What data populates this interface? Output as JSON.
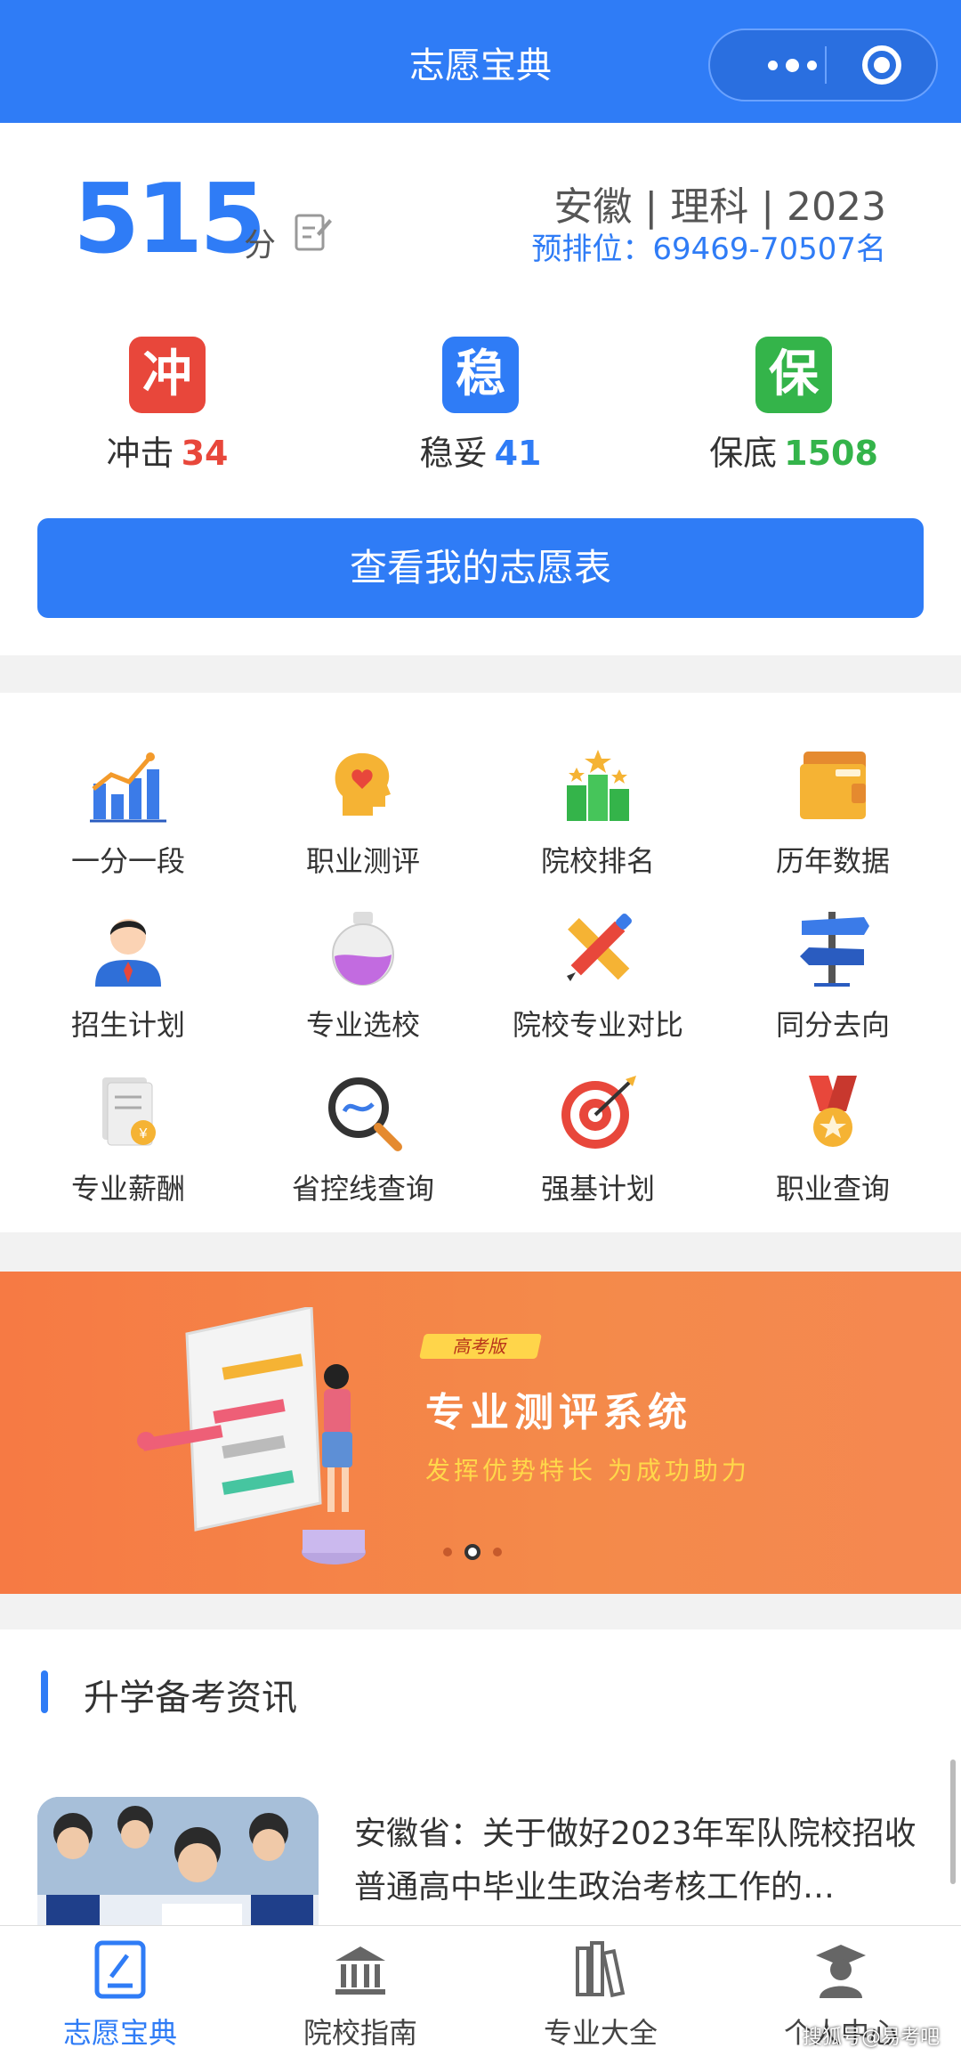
{
  "header": {
    "title": "志愿宝典"
  },
  "score": {
    "value": "515",
    "unit": "分",
    "region": "安徽 | 理科 | 2023",
    "rank": "预排位：69469-70507名"
  },
  "categories": [
    {
      "badge": "冲",
      "label": "冲击",
      "count": "34",
      "color": "#e8473b"
    },
    {
      "badge": "稳",
      "label": "稳妥",
      "count": "41",
      "color": "#2f7cf6"
    },
    {
      "badge": "保",
      "label": "保底",
      "count": "1508",
      "color": "#34b44a"
    }
  ],
  "main_button": "查看我的志愿表",
  "features": [
    {
      "label": "一分一段",
      "icon": "bar-chart-icon"
    },
    {
      "label": "职业测评",
      "icon": "head-heart-icon"
    },
    {
      "label": "院校排名",
      "icon": "ranking-podium-icon"
    },
    {
      "label": "历年数据",
      "icon": "folder-data-icon"
    },
    {
      "label": "招生计划",
      "icon": "person-icon"
    },
    {
      "label": "专业选校",
      "icon": "flask-icon"
    },
    {
      "label": "院校专业对比",
      "icon": "pencil-ruler-icon"
    },
    {
      "label": "同分去向",
      "icon": "signpost-icon"
    },
    {
      "label": "专业薪酬",
      "icon": "document-coin-icon"
    },
    {
      "label": "省控线查询",
      "icon": "magnifier-icon"
    },
    {
      "label": "强基计划",
      "icon": "target-icon"
    },
    {
      "label": "职业查询",
      "icon": "medal-icon"
    }
  ],
  "banner": {
    "tag": "高考版",
    "title": "专业测评系统",
    "subtitle": "发挥优势特长 为成功助力",
    "active_slide": 2,
    "slide_count": 3
  },
  "news": {
    "section_title": "升学备考资讯",
    "items": [
      {
        "text": "安徽省：关于做好2023年军队院校招收普通高中毕业生政治考核工作的…"
      }
    ]
  },
  "tabs": [
    {
      "label": "志愿宝典",
      "icon": "book-icon",
      "active": true
    },
    {
      "label": "院校指南",
      "icon": "university-icon",
      "active": false
    },
    {
      "label": "专业大全",
      "icon": "books-icon",
      "active": false
    },
    {
      "label": "个人中心",
      "icon": "graduate-icon",
      "active": false
    }
  ],
  "watermark": "搜狐号@易考吧"
}
